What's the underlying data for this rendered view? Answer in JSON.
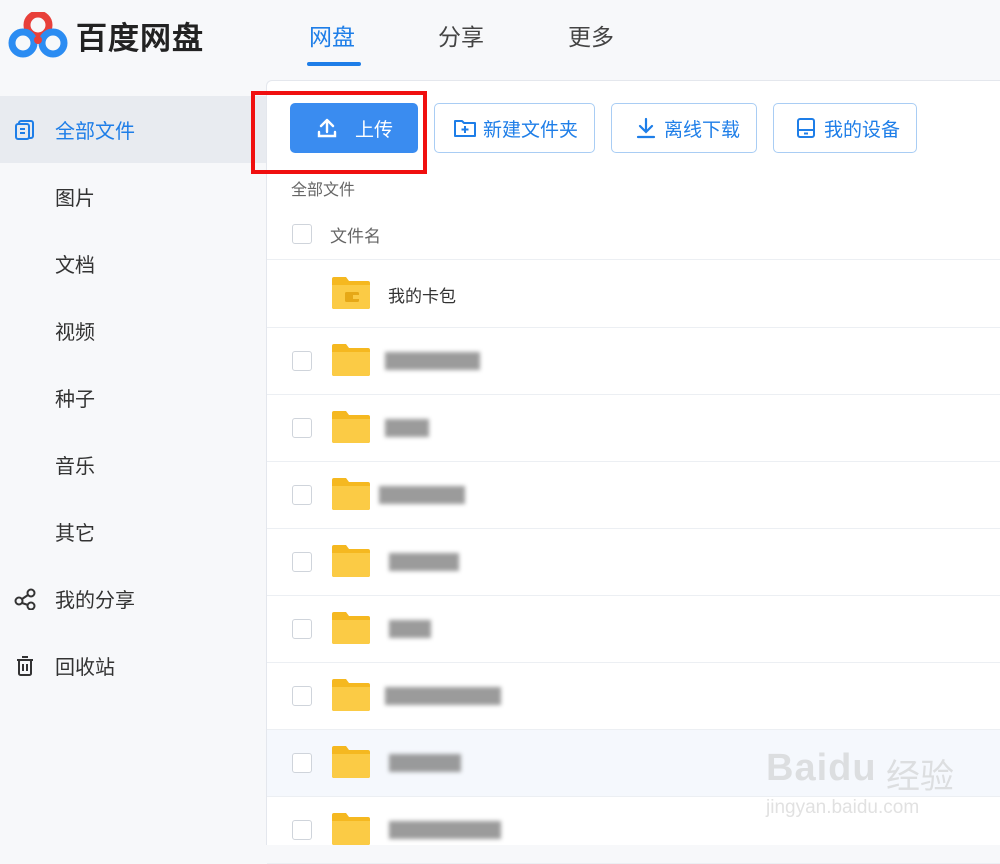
{
  "app": {
    "title": "百度网盘"
  },
  "nav": {
    "tabs": [
      {
        "label": "网盘"
      },
      {
        "label": "分享"
      },
      {
        "label": "更多"
      }
    ]
  },
  "sidebar": {
    "items": [
      {
        "label": "全部文件",
        "icon": "files-icon"
      },
      {
        "label": "图片"
      },
      {
        "label": "文档"
      },
      {
        "label": "视频"
      },
      {
        "label": "种子"
      },
      {
        "label": "音乐"
      },
      {
        "label": "其它"
      },
      {
        "label": "我的分享",
        "icon": "share-icon"
      },
      {
        "label": "回收站",
        "icon": "trash-icon"
      }
    ]
  },
  "toolbar": {
    "upload": "上传",
    "new_folder": "新建文件夹",
    "offline_download": "离线下载",
    "my_devices": "我的设备"
  },
  "breadcrumb": "全部文件",
  "table": {
    "column_name": "文件名",
    "rows": [
      {
        "name": "我的卡包"
      }
    ]
  },
  "watermark": {
    "brand": "Baidu",
    "cn": "经验",
    "url": "jingyan.baidu.com"
  },
  "colors": {
    "accent": "#1e7ee8",
    "folder": "#fbcb45",
    "highlight": "#f00f0f"
  }
}
